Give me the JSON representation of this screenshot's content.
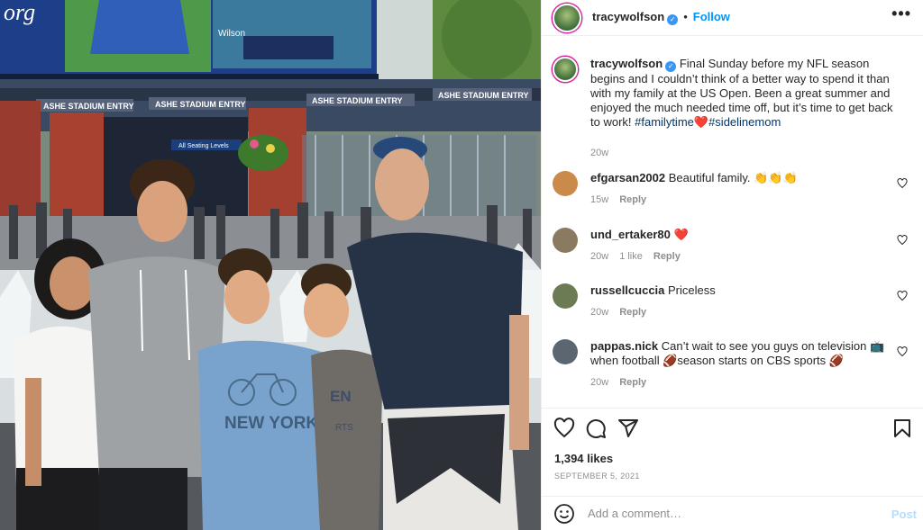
{
  "post": {
    "author": "tracywolfson",
    "follow_label": "Follow",
    "separator": "•",
    "more_label": "•••",
    "caption": "Final Sunday before my NFL season begins and I couldn’t think of a better way to spend it than with my family at the US Open. Been a great summer and enjoyed the much needed time off, but it’s time to get back to work!",
    "hashtags": [
      "#familytime",
      "#sidelinemom"
    ],
    "caption_heart": "❤️",
    "caption_age": "20w",
    "likes": "1,394 likes",
    "date": "SEPTEMBER 5, 2021"
  },
  "photo": {
    "signs": [
      "ASHE STADIUM ENTRY",
      "ASHE STADIUM ENTRY",
      "ASHE STADIUM ENTRY",
      "ASHE STADIUM ENTRY"
    ],
    "directional_sign": "All Seating Levels",
    "screen_logo": "org",
    "scoreboard_brand": "Wilson",
    "shirt_text": "NEW YORK",
    "shirt_text_2": "EN",
    "shirt_text_3": "RTS"
  },
  "comments": [
    {
      "user": "efgarsan2002",
      "text": "Beautiful family. 👏👏👏",
      "age": "15w",
      "likes": "",
      "reply": "Reply",
      "avatar_color": "#c98a4a"
    },
    {
      "user": "und_ertaker80",
      "text": "❤️",
      "age": "20w",
      "likes": "1 like",
      "reply": "Reply",
      "avatar_color": "#8a7a62"
    },
    {
      "user": "russellcuccia",
      "text": "Priceless",
      "age": "20w",
      "likes": "",
      "reply": "Reply",
      "avatar_color": "#6d7b55"
    },
    {
      "user": "pappas.nick",
      "text": "Can’t wait to see you guys on television 📺 when football 🏈season starts on CBS sports 🏈",
      "age": "20w",
      "likes": "",
      "reply": "Reply",
      "avatar_color": "#5b6670"
    }
  ],
  "composer": {
    "placeholder": "Add a comment…",
    "post_label": "Post"
  },
  "colors": {
    "accent": "#0095f6",
    "heart": "#ed4956",
    "muted": "#8e8e8e"
  },
  "icons": [
    "heart-icon",
    "comment-icon",
    "share-icon",
    "bookmark-icon",
    "emoji-icon",
    "verified-icon",
    "more-icon"
  ]
}
